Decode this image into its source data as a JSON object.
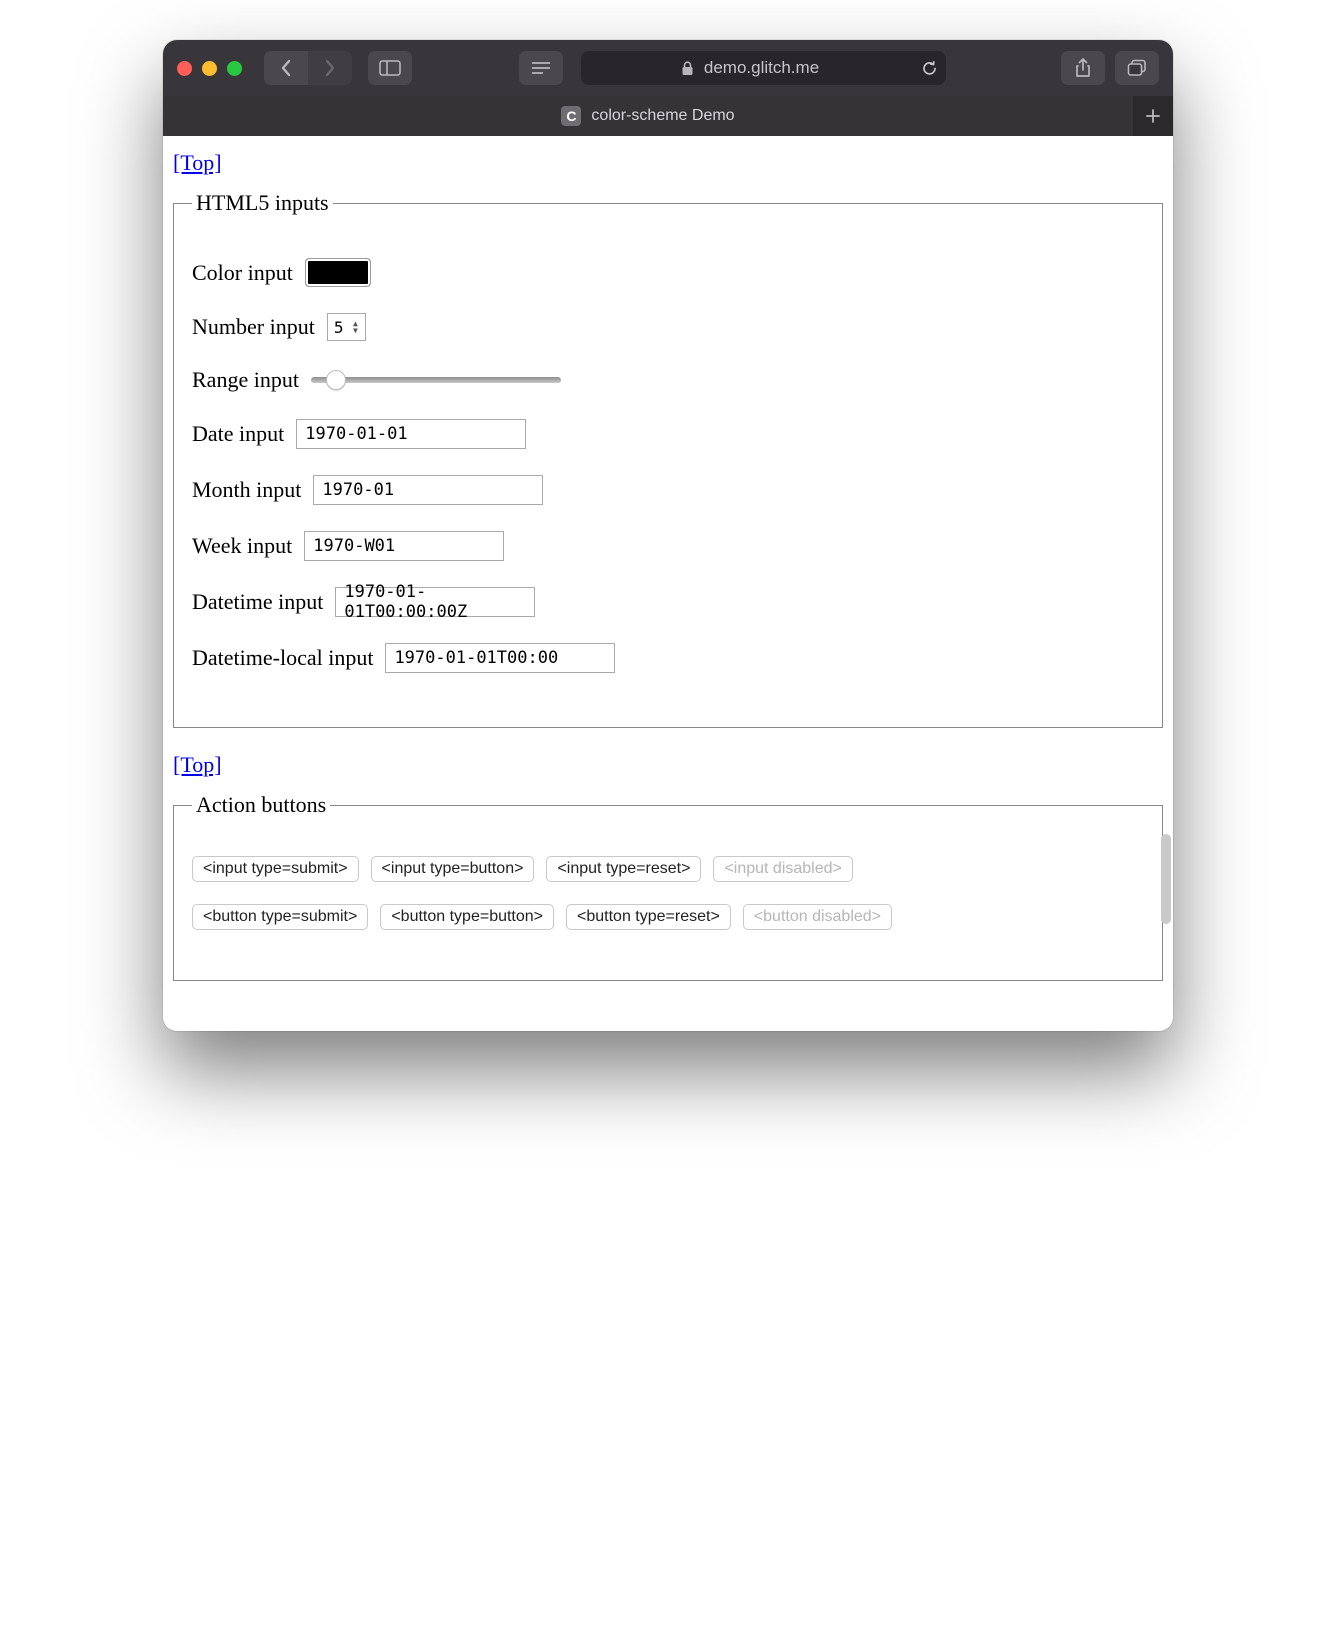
{
  "browser": {
    "address": "demo.glitch.me",
    "tab_title": "color-scheme Demo",
    "favicon_letter": "C"
  },
  "links": {
    "top": "[Top]"
  },
  "fieldsets": {
    "html5_inputs": {
      "legend": "HTML5 inputs",
      "color": {
        "label": "Color input",
        "value": "#000000"
      },
      "number": {
        "label": "Number input",
        "value": "5"
      },
      "range": {
        "label": "Range input",
        "value": 10,
        "min": 0,
        "max": 100
      },
      "date": {
        "label": "Date input",
        "value": "1970-01-01"
      },
      "month": {
        "label": "Month input",
        "value": "1970-01"
      },
      "week": {
        "label": "Week input",
        "value": "1970-W01"
      },
      "datetime": {
        "label": "Datetime input",
        "value": "1970-01-01T00:00:00Z"
      },
      "datetime_local": {
        "label": "Datetime-local input",
        "value": "1970-01-01T00:00"
      }
    },
    "action_buttons": {
      "legend": "Action buttons",
      "inputs": {
        "submit": "<input type=submit>",
        "button": "<input type=button>",
        "reset": "<input type=reset>",
        "disabled": "<input disabled>"
      },
      "buttons": {
        "submit": "<button type=submit>",
        "button": "<button type=button>",
        "reset": "<button type=reset>",
        "disabled": "<button disabled>"
      }
    }
  }
}
